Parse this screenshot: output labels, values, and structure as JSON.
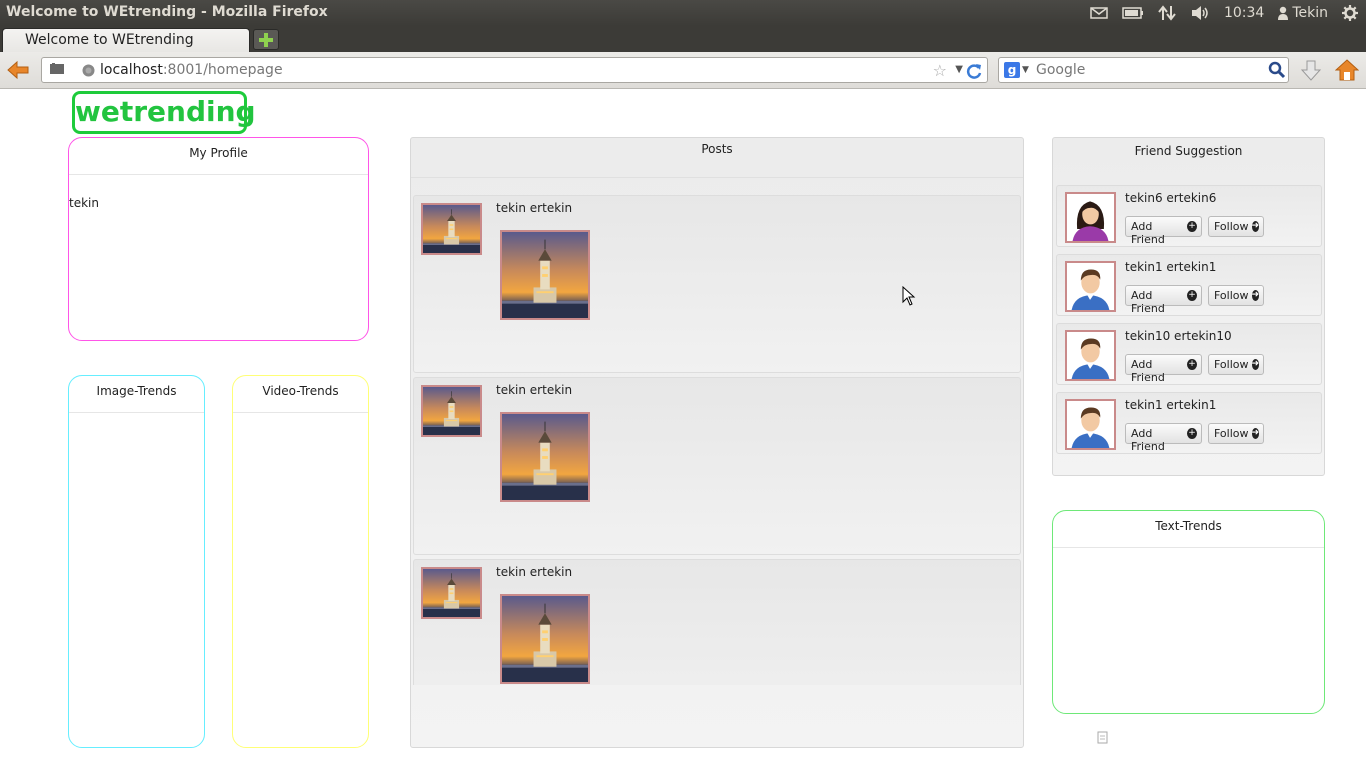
{
  "window": {
    "title": "Welcome to WEtrending - Mozilla Firefox"
  },
  "tray": {
    "time": "10:34",
    "user": "Tekin"
  },
  "browser": {
    "tab_title": "Welcome to WEtrending",
    "url_host": "localhost",
    "url_rest": ":8001/homepage",
    "search_placeholder": "Google"
  },
  "page": {
    "logo": "wetrending",
    "profile": {
      "title": "My Profile",
      "username": "tekin"
    },
    "image_trends": {
      "title": "Image-Trends"
    },
    "video_trends": {
      "title": "Video-Trends"
    },
    "text_trends": {
      "title": "Text-Trends"
    },
    "posts": {
      "title": "Posts",
      "items": [
        {
          "author": "tekin ertekin"
        },
        {
          "author": "tekin ertekin"
        },
        {
          "author": "tekin ertekin"
        }
      ]
    },
    "friends": {
      "title": "Friend Suggestion",
      "add_label": "Add Friend",
      "follow_label": "Follow",
      "items": [
        {
          "name": "tekin6 ertekin6",
          "avatar": "female-avatar-icon"
        },
        {
          "name": "tekin1 ertekin1",
          "avatar": "male-avatar-icon"
        },
        {
          "name": "tekin10 ertekin10",
          "avatar": "male-avatar-icon"
        },
        {
          "name": "tekin1 ertekin1",
          "avatar": "male-avatar-icon"
        }
      ]
    }
  },
  "colors": {
    "logo": "#22c43f",
    "profile_border": "#ff55e8",
    "image_trends_border": "#66eeff",
    "video_trends_border": "#ffff77",
    "text_trends_border": "#6ee878"
  }
}
